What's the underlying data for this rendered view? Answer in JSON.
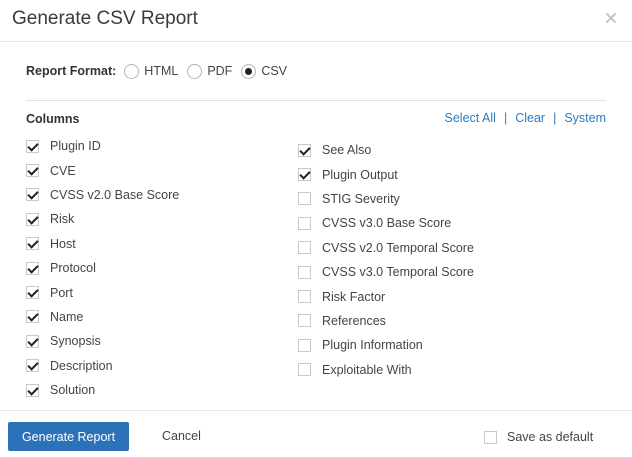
{
  "dialog": {
    "title": "Generate CSV Report",
    "close_icon": "close-icon"
  },
  "report_format": {
    "label": "Report Format:",
    "options": [
      {
        "label": "HTML",
        "checked": false
      },
      {
        "label": "PDF",
        "checked": false
      },
      {
        "label": "CSV",
        "checked": true
      }
    ]
  },
  "columns": {
    "heading": "Columns",
    "actions": {
      "select_all": "Select All",
      "clear": "Clear",
      "system": "System",
      "separator": "|"
    },
    "left": [
      {
        "label": "Plugin ID",
        "checked": true
      },
      {
        "label": "CVE",
        "checked": true
      },
      {
        "label": "CVSS v2.0 Base Score",
        "checked": true
      },
      {
        "label": "Risk",
        "checked": true
      },
      {
        "label": "Host",
        "checked": true
      },
      {
        "label": "Protocol",
        "checked": true
      },
      {
        "label": "Port",
        "checked": true
      },
      {
        "label": "Name",
        "checked": true
      },
      {
        "label": "Synopsis",
        "checked": true
      },
      {
        "label": "Description",
        "checked": true
      },
      {
        "label": "Solution",
        "checked": true
      }
    ],
    "right": [
      {
        "label": "See Also",
        "checked": true
      },
      {
        "label": "Plugin Output",
        "checked": true
      },
      {
        "label": "STIG Severity",
        "checked": false
      },
      {
        "label": "CVSS v3.0 Base Score",
        "checked": false
      },
      {
        "label": "CVSS v2.0 Temporal Score",
        "checked": false
      },
      {
        "label": "CVSS v3.0 Temporal Score",
        "checked": false
      },
      {
        "label": "Risk Factor",
        "checked": false
      },
      {
        "label": "References",
        "checked": false
      },
      {
        "label": "Plugin Information",
        "checked": false
      },
      {
        "label": "Exploitable With",
        "checked": false
      }
    ]
  },
  "footer": {
    "generate_label": "Generate Report",
    "cancel_label": "Cancel",
    "save_default_label": "Save as default",
    "save_default_checked": false
  },
  "colors": {
    "primary": "#2c72b8",
    "link": "#2f7bbf"
  }
}
